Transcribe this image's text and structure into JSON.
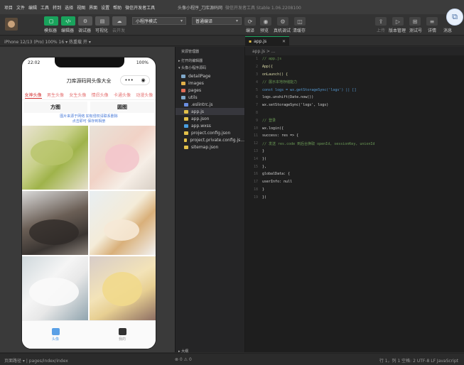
{
  "menu": [
    "项目",
    "文件",
    "编辑",
    "工具",
    "转到",
    "选择",
    "视图",
    "界面",
    "设置",
    "帮助",
    "微信开发者工具"
  ],
  "window": {
    "title": "头像小程序_刀库源码网",
    "subtitle": "微信开发者工具 Stable 1.06.2208100"
  },
  "toolbar": {
    "btn_labels": [
      "模拟器",
      "编辑器",
      "调试器",
      "可视化",
      "云开发"
    ],
    "mode_select": "小程序模式",
    "compile_select": "普通编译",
    "actions": [
      "编译",
      "预览",
      "真机调试",
      "清缓存"
    ],
    "right_actions": [
      "上传",
      "版本管理",
      "测试号",
      "详情",
      "消息"
    ]
  },
  "device": {
    "label": "iPhone 12/13 (Pro) 100% 16 ▾",
    "hotreload": "热重载 开 ▾"
  },
  "editor_tab": {
    "label": "app.js"
  },
  "phone": {
    "time": "22:02",
    "battery": "100%",
    "title": "刀库源码网头像大全",
    "capsule_more": "•••",
    "capsule_close": "◉",
    "categories": [
      "女神头像",
      "男生头像",
      "女生头像",
      "情侣头像",
      "卡通头像",
      "动漫头像"
    ],
    "square_tabs": [
      "方图",
      "圆图"
    ],
    "notice_line1": "图片来源于网络 如有侵权请联系删除",
    "notice_line2": "点击即可 保存到相册",
    "tabs": [
      "头像",
      "我的"
    ]
  },
  "explorer": {
    "header": "资源管理器",
    "sections": [
      "▸ 打开的编辑器",
      "▾ 头像小程序源码"
    ],
    "files": [
      {
        "name": "detailPage",
        "color": "#7fa7c9"
      },
      {
        "name": "images",
        "color": "#e2b04a"
      },
      {
        "name": "pages",
        "color": "#e06c55"
      },
      {
        "name": "utils",
        "color": "#7fa7c9"
      },
      {
        "name": ".eslintrc.js",
        "color": "#6a8ee0"
      },
      {
        "name": "app.js",
        "color": "#e2c04a"
      },
      {
        "name": "app.json",
        "color": "#e2c04a"
      },
      {
        "name": "app.wxss",
        "color": "#4a9ee0"
      },
      {
        "name": "project.config.json",
        "color": "#e2c04a"
      },
      {
        "name": "project.private.config.js...",
        "color": "#e2c04a"
      },
      {
        "name": "sitemap.json",
        "color": "#e2c04a"
      }
    ],
    "footer": "▸ 大纲"
  },
  "code_path": "app.js > ...",
  "code": [
    {
      "n": "1",
      "t": "// app.js",
      "c": "comment"
    },
    {
      "n": "2",
      "t": "App({",
      "c": "fn"
    },
    {
      "n": "3",
      "t": "  onLaunch() {",
      "c": "fn"
    },
    {
      "n": "4",
      "t": "    // 展示本地存储能力",
      "c": "comment"
    },
    {
      "n": "5",
      "t": "    const logs = wx.getStorageSync('logs') || []",
      "c": "kw"
    },
    {
      "n": "6",
      "t": "    logs.unshift(Date.now())",
      "c": ""
    },
    {
      "n": "7",
      "t": "    wx.setStorageSync('logs', logs)",
      "c": ""
    },
    {
      "n": "8",
      "t": "",
      "c": ""
    },
    {
      "n": "9",
      "t": "    // 登录",
      "c": "comment"
    },
    {
      "n": "10",
      "t": "    wx.login({",
      "c": ""
    },
    {
      "n": "11",
      "t": "      success: res => {",
      "c": ""
    },
    {
      "n": "12",
      "t": "        // 发送 res.code 到后台换取 openId, sessionKey, unionId",
      "c": "comment"
    },
    {
      "n": "13",
      "t": "      }",
      "c": ""
    },
    {
      "n": "14",
      "t": "    })",
      "c": ""
    },
    {
      "n": "15",
      "t": "  },",
      "c": ""
    },
    {
      "n": "16",
      "t": "  globalData: {",
      "c": ""
    },
    {
      "n": "17",
      "t": "    userInfo: null",
      "c": ""
    },
    {
      "n": "18",
      "t": "  }",
      "c": ""
    },
    {
      "n": "19",
      "t": "})",
      "c": ""
    }
  ],
  "status": {
    "left": "页面路径 ▾ | pages/index/index",
    "mid": "⊗ 0 ⚠ 0",
    "right": "行 1，列 1   空格: 2   UTF-8   LF   JavaScript"
  }
}
